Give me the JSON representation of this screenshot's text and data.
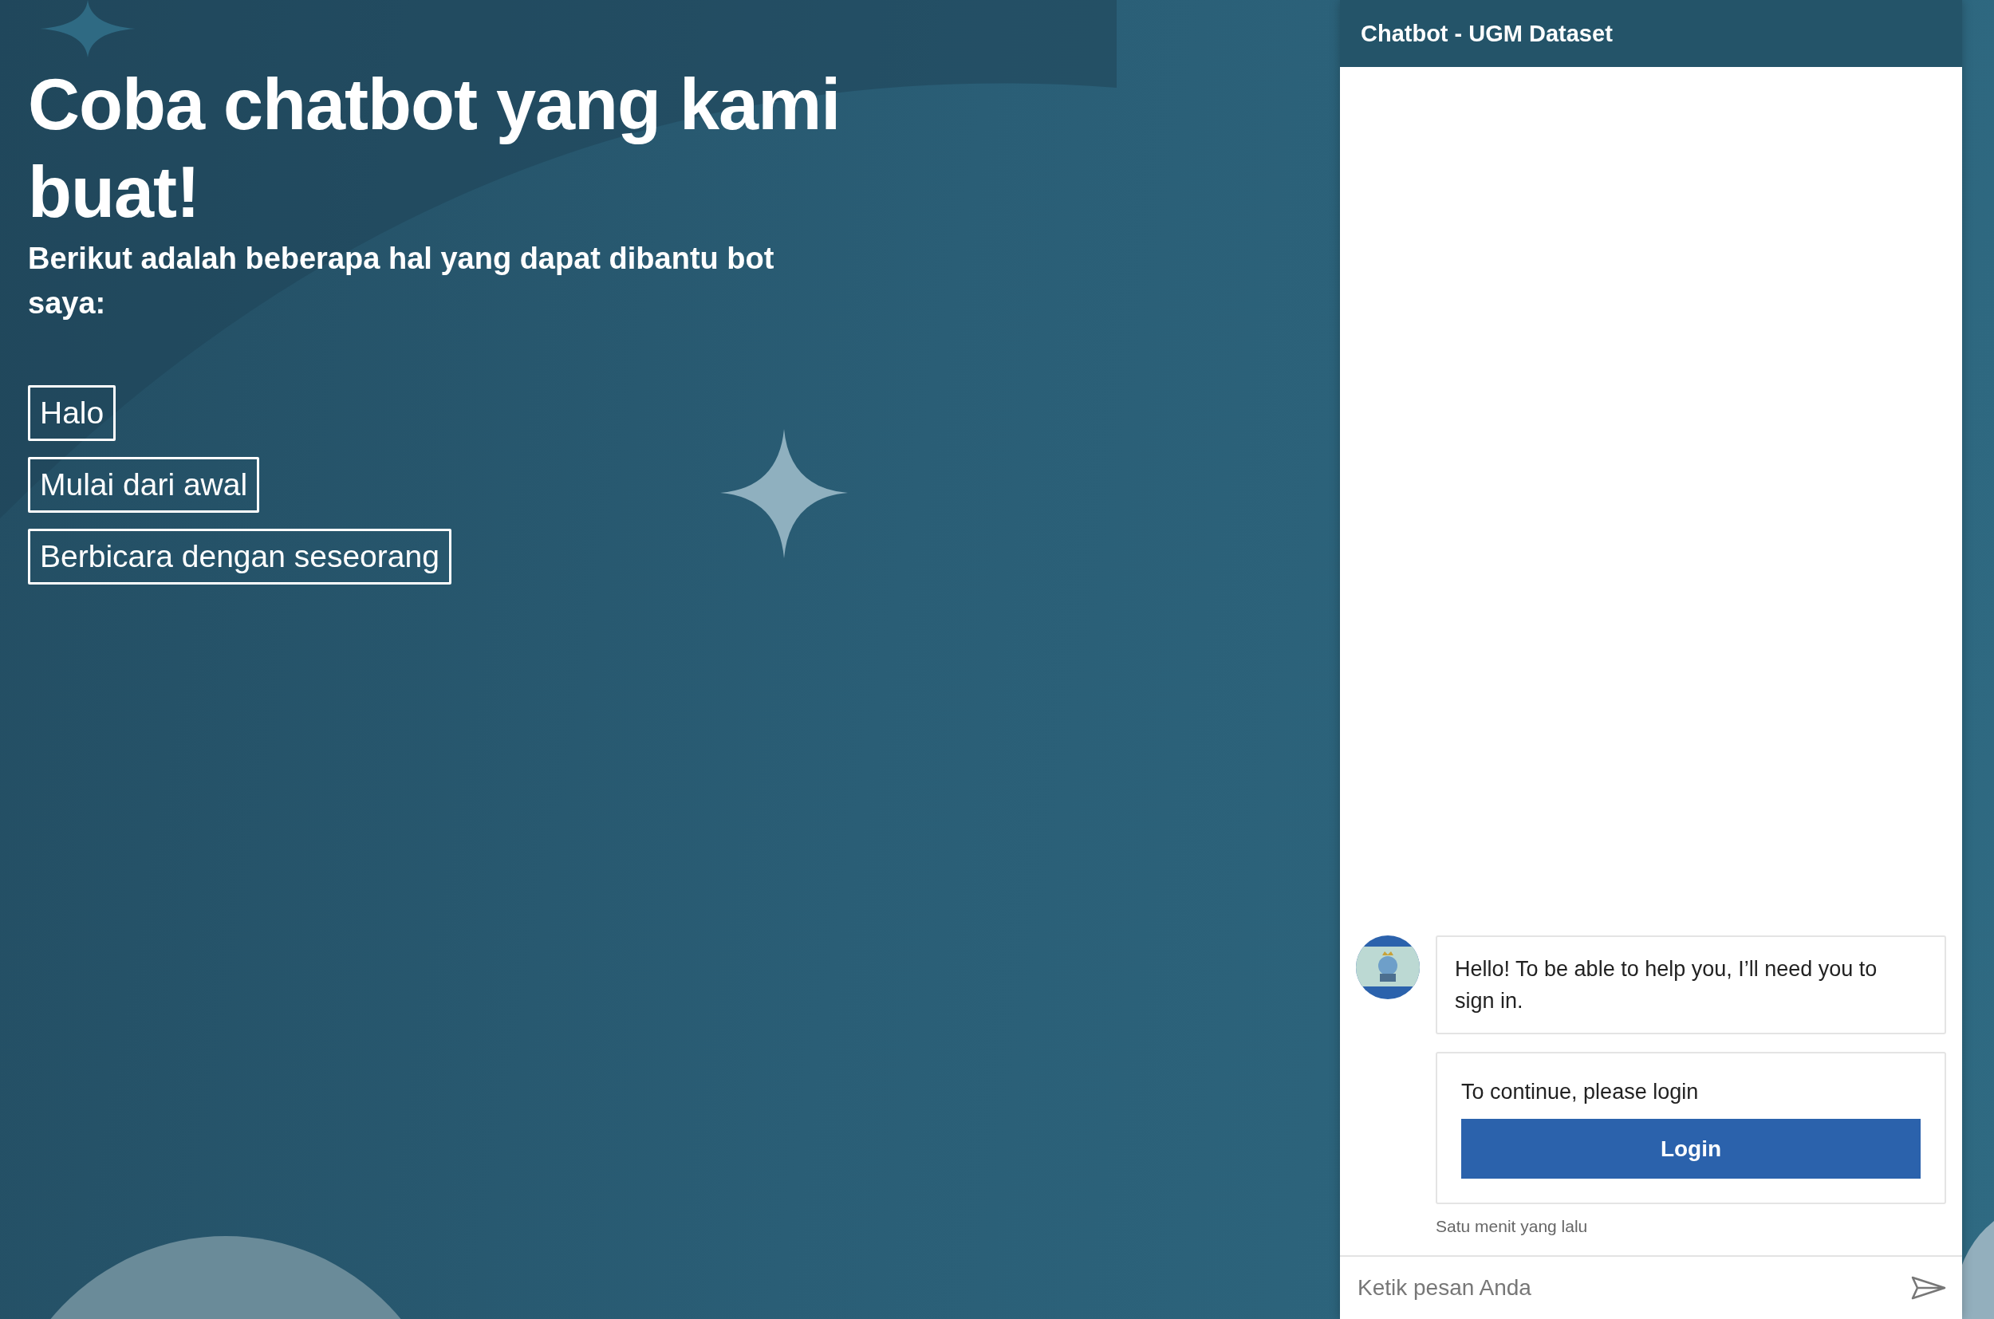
{
  "hero": {
    "title": "Coba chatbot yang kami buat!",
    "subtitle": "Berikut adalah beberapa hal yang dapat dibantu bot saya:"
  },
  "suggestions": [
    "Halo",
    "Mulai dari awal",
    "Berbicara dengan seseorang"
  ],
  "chat": {
    "title": "Chatbot - UGM Dataset",
    "messages": [
      {
        "kind": "text",
        "text": "Hello! To be able to help you, I’ll need you to sign in."
      },
      {
        "kind": "card",
        "text": "To continue, please login",
        "button": "Login"
      }
    ],
    "timestamp": "Satu menit yang lalu",
    "input": {
      "placeholder": "Ketik pesan Anda"
    }
  }
}
